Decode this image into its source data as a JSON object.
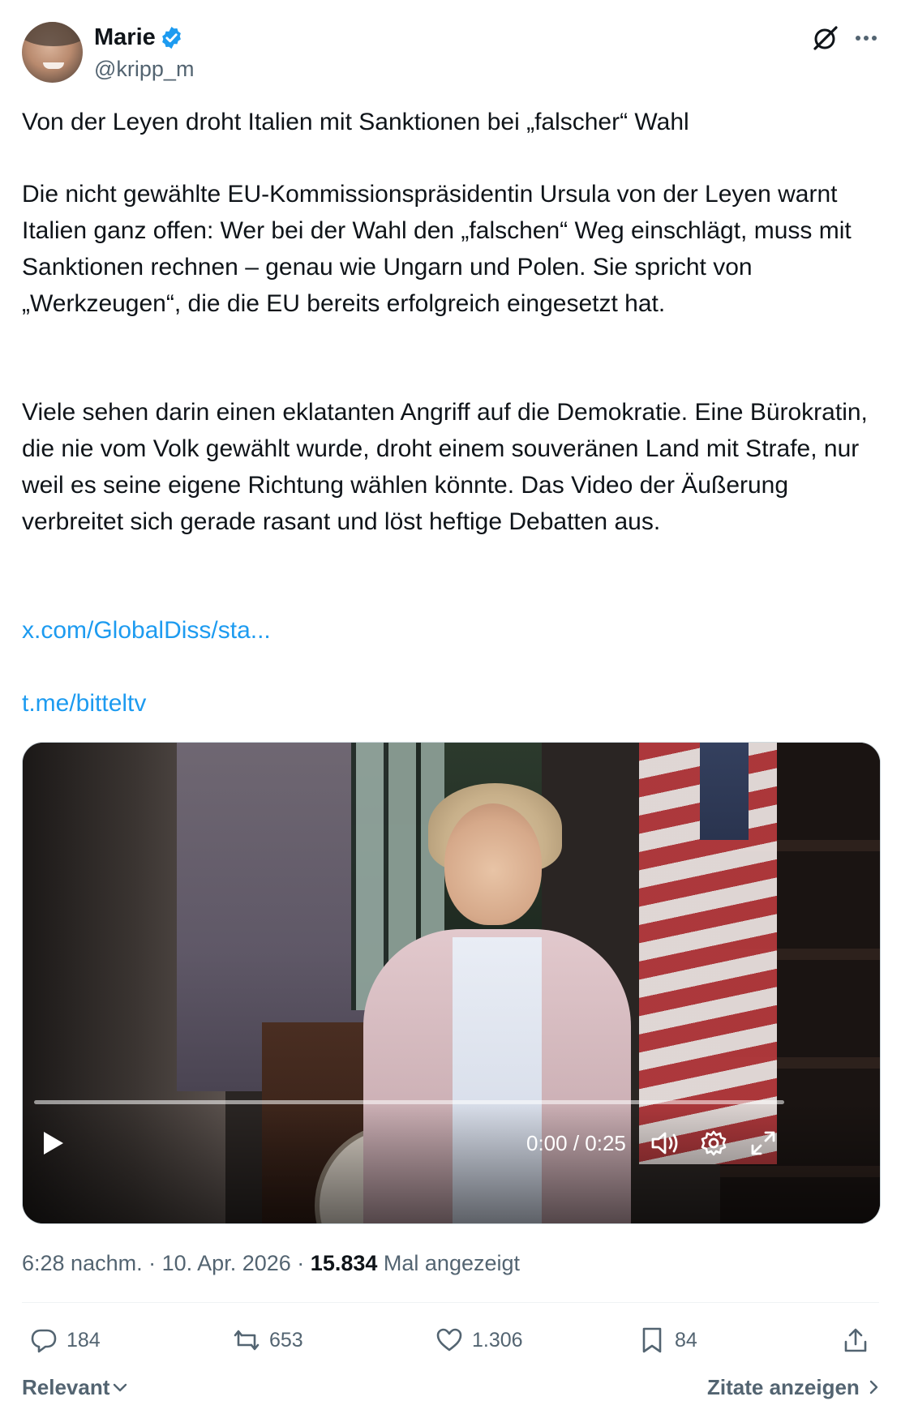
{
  "author": {
    "name": "Marie",
    "handle": "@kripp_m",
    "verified": true,
    "verified_color": "#1d9bf0"
  },
  "tweet": {
    "paragraphs": [
      "Von der Leyen droht Italien mit Sanktionen bei „falscher“ Wahl",
      "Die nicht gewählte EU-Kommissionspräsidentin Ursula von der Leyen warnt Italien ganz offen: Wer bei der Wahl den „falschen“ Weg einschlägt, muss mit Sanktionen rechnen – genau wie Ungarn und Polen. Sie spricht von „Werkzeugen“, die die EU bereits erfolgreich eingesetzt hat.",
      "Viele sehen darin einen eklatanten Angriff auf die Demokratie. Eine Bürokratin, die nie vom Volk gewählt wurde, droht einem souveränen Land mit Strafe, nur weil es seine eigene Richtung wählen könnte. Das Video der Äußerung verbreitet sich gerade rasant und löst heftige Debatten aus."
    ],
    "links": [
      "x.com/GlobalDiss/sta...",
      "t.me/bitteltv"
    ],
    "link_color": "#1d9bf0"
  },
  "video": {
    "time_display": "0:00 / 0:25",
    "progress": 0
  },
  "meta": {
    "time": "6:28 nachm.",
    "separator": "·",
    "date": "10. Apr. 2026",
    "views": "15.834",
    "views_label": "Mal angezeigt"
  },
  "actions": {
    "replies": "184",
    "reposts": "653",
    "likes": "1.306",
    "bookmarks": "84"
  },
  "footer": {
    "sort_label": "Relevant",
    "quotes_label": "Zitate anzeigen"
  },
  "icons": {
    "header": [
      "grok-icon",
      "more-icon"
    ],
    "video_controls": [
      "play-icon",
      "volume-icon",
      "settings-gear-icon",
      "fullscreen-icon"
    ],
    "actions": [
      "reply-icon",
      "repost-icon",
      "like-icon",
      "bookmark-icon",
      "share-icon"
    ]
  }
}
